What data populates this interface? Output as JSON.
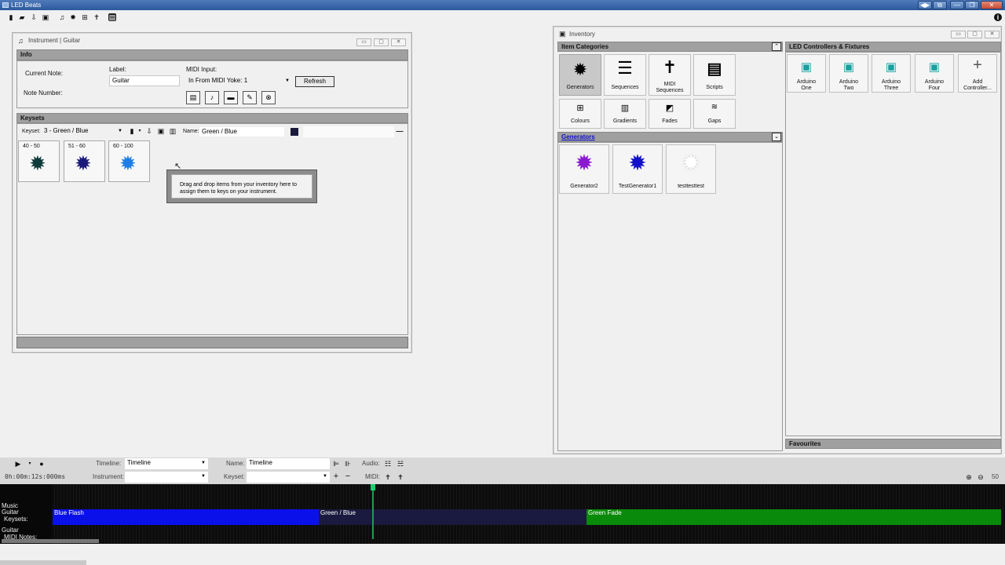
{
  "app": {
    "title": "LED Beats",
    "window_buttons": [
      "◀▶",
      "⧉",
      "—",
      "❐",
      "✕"
    ]
  },
  "toolbar": {
    "icons": [
      "new-file-icon",
      "open-folder-icon",
      "import-icon",
      "save-icon",
      "music-note-icon",
      "gear-icon",
      "sliders-icon",
      "midi-figure-icon",
      "led-controller-icon"
    ],
    "info_icon": "info-icon"
  },
  "instrument_window": {
    "title": "Instrument | Guitar",
    "info": {
      "header": "Info",
      "current_note_label": "Current Note:",
      "note_number_label": "Note Number:",
      "label_caption": "Label:",
      "label_value": "Guitar",
      "midi_input_caption": "MIDI Input:",
      "midi_input_value": "In From MIDI Yoke:  1",
      "refresh_label": "Refresh",
      "instrument_icons": [
        "keyboard-icon",
        "guitar-icon",
        "keys-icon",
        "drum-stick-icon",
        "drum-icon"
      ]
    },
    "keysets": {
      "header": "Keysets",
      "keyset_caption": "Keyset:",
      "keyset_value": "3 - Green / Blue",
      "name_caption": "Name:",
      "name_value": "Green / Blue",
      "swatch_color": "#1a1a3a",
      "cards": [
        {
          "range": "40 - 50",
          "color": "#0f3a3a"
        },
        {
          "range": "51 - 60",
          "color": "#1a1a7a"
        },
        {
          "range": "60 - 100",
          "color": "#1e7ee6"
        }
      ],
      "tooltip": "Drag and drop items from your inventory here to assign them to keys on your instrument."
    }
  },
  "inventory_window": {
    "title": "Inventory",
    "categories_header": "Item Categories",
    "categories": [
      {
        "label": "Generators",
        "icon": "gear-icon",
        "selected": true
      },
      {
        "label": "Sequences",
        "icon": "sliders-icon",
        "selected": false
      },
      {
        "label": "MIDI Sequences",
        "icon": "midi-figure-icon",
        "selected": false
      },
      {
        "label": "Scripts",
        "icon": "script-icon",
        "selected": false
      },
      {
        "label": "Colours",
        "icon": "colour-icon",
        "selected": false
      },
      {
        "label": "Gradients",
        "icon": "gradient-icon",
        "selected": false
      },
      {
        "label": "Fades",
        "icon": "fade-icon",
        "selected": false
      },
      {
        "label": "Gaps",
        "icon": "gap-icon",
        "selected": false
      }
    ],
    "generators_header": "Generators",
    "generators": [
      {
        "label": "Generator2",
        "color": "#8a1ad0"
      },
      {
        "label": "TestGenerator1",
        "color": "#1010c8"
      },
      {
        "label": "testtesttest",
        "color": "#ffffff"
      }
    ],
    "controllers_header": "LED Controllers & Fixtures",
    "controllers": [
      {
        "label": "Arduino One"
      },
      {
        "label": "Arduino Two"
      },
      {
        "label": "Arduino Three"
      },
      {
        "label": "Arduino Four"
      },
      {
        "label": "Add Controller..."
      }
    ],
    "favourites_header": "Favourites"
  },
  "transport": {
    "time": "0h:00m:12s:000ms",
    "timeline_caption": "Timeline:",
    "timeline_value": "Timeline",
    "name_caption": "Name:",
    "name_value": "Timeline",
    "instrument_caption": "Instrument:",
    "instrument_value": "",
    "keyset_caption": "Keyset:",
    "keyset_value": "",
    "audio_caption": "Audio:",
    "midi_caption": "MIDI:",
    "zoom_value": "50"
  },
  "timeline": {
    "rows": [
      {
        "label_line1": "",
        "label_line2": "Music"
      },
      {
        "label_line1": "Guitar",
        "label_line2": "Keysets:"
      },
      {
        "label_line1": "Guitar",
        "label_line2": "MIDI Notes:"
      }
    ],
    "clips": [
      {
        "label": "Blue Flash",
        "color": "#0a10ea"
      },
      {
        "label": "Green / Blue",
        "color": "#1a1a40"
      },
      {
        "label": "Green Fade",
        "color": "#0a8a0a"
      }
    ]
  }
}
